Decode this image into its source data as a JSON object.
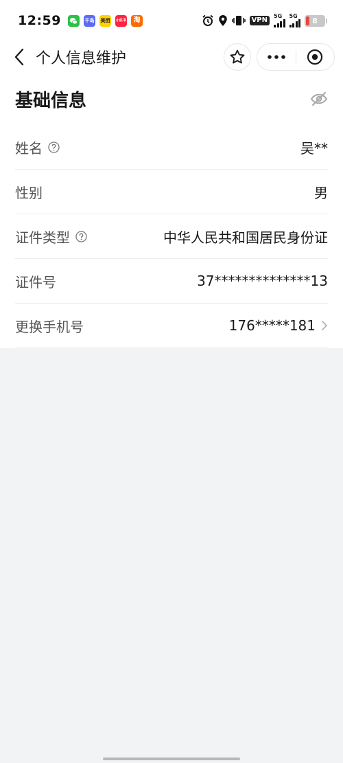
{
  "status_bar": {
    "time": "12:59",
    "vpn": "VPN",
    "sim1": "5G",
    "sim2": "5G",
    "battery": "8",
    "apps": [
      {
        "name": "wechat-app-icon",
        "color": "#2bc048",
        "label": ""
      },
      {
        "name": "qianduo-app-icon",
        "color": "#5b6cf5",
        "label": "千岛"
      },
      {
        "name": "meituan-app-icon",
        "color": "#ffd100",
        "label": "美团"
      },
      {
        "name": "xiaohongshu-app-icon",
        "color": "#ff2442",
        "label": "小红书"
      },
      {
        "name": "taobao-app-icon",
        "color": "#ff6a00",
        "label": "淘"
      }
    ]
  },
  "nav": {
    "title": "个人信息维护"
  },
  "section": {
    "title": "基础信息"
  },
  "rows": [
    {
      "label": "姓名",
      "value": "吴**",
      "help": true,
      "chevron": false
    },
    {
      "label": "性别",
      "value": "男",
      "help": false,
      "chevron": false
    },
    {
      "label": "证件类型",
      "value": "中华人民共和国居民身份证",
      "help": true,
      "chevron": false
    },
    {
      "label": "证件号",
      "value": "37**************13",
      "help": false,
      "chevron": false
    },
    {
      "label": "更换手机号",
      "value": "176*****181",
      "help": false,
      "chevron": true
    }
  ],
  "colors": {
    "background": "#f2f3f5",
    "card": "#ffffff",
    "label": "#555555",
    "value": "#1a1a1a"
  }
}
